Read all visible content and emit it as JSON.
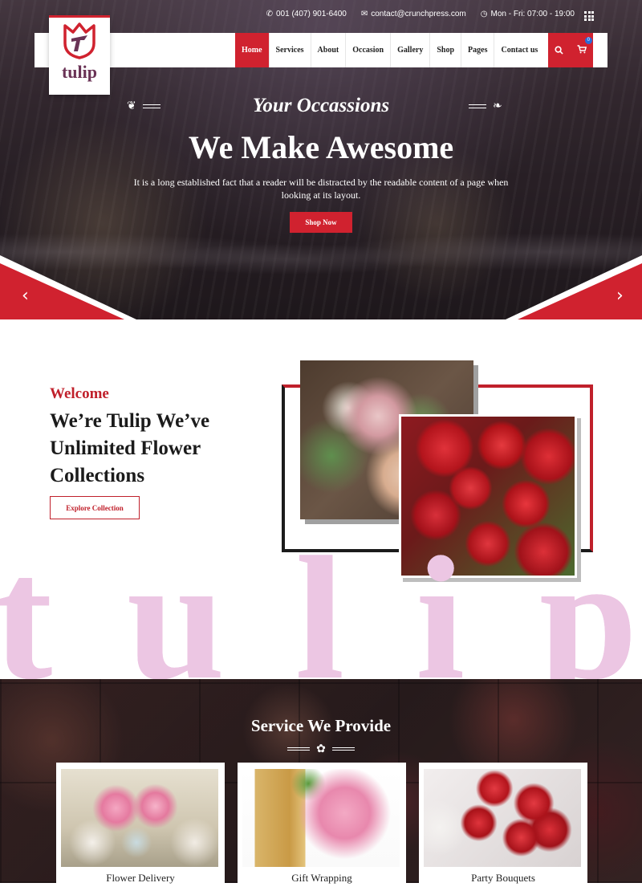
{
  "topbar": {
    "phone": "001 (407) 901-6400",
    "email": "contact@crunchpress.com",
    "hours": "Mon - Fri: 07:00 - 19:00"
  },
  "logo": {
    "text": "tulip"
  },
  "nav": {
    "items": [
      {
        "label": "Home",
        "active": true
      },
      {
        "label": "Services"
      },
      {
        "label": "About"
      },
      {
        "label": "Occasion"
      },
      {
        "label": "Gallery"
      },
      {
        "label": "Shop"
      },
      {
        "label": "Pages"
      },
      {
        "label": "Contact us"
      }
    ],
    "cart_count": "0"
  },
  "hero": {
    "subtitle": "Your Occassions",
    "title": "We Make Awesome",
    "text": "It is a long established fact that a reader will be distracted by the readable content of a page when looking at its layout.",
    "button": "Shop Now"
  },
  "about": {
    "eyebrow": "Welcome",
    "title": "We’re Tulip We’ve Unlimited Flower Collections",
    "button": "Explore Collection",
    "bigword": [
      "t",
      "u",
      "l",
      "i",
      "p"
    ]
  },
  "services": {
    "title": "Service We Provide",
    "cards": [
      {
        "label": "Flower Delivery"
      },
      {
        "label": "Gift Wrapping"
      },
      {
        "label": "Party Bouquets"
      }
    ]
  },
  "colors": {
    "accent": "#d0222f",
    "brand_text": "#6a3356",
    "watermark": "#ecc6e3"
  },
  "icons": [
    "phone-icon",
    "mail-icon",
    "clock-icon",
    "grid-menu-icon",
    "search-icon",
    "cart-icon",
    "prev-arrow-icon",
    "next-arrow-icon",
    "flower-ornament-icon"
  ]
}
